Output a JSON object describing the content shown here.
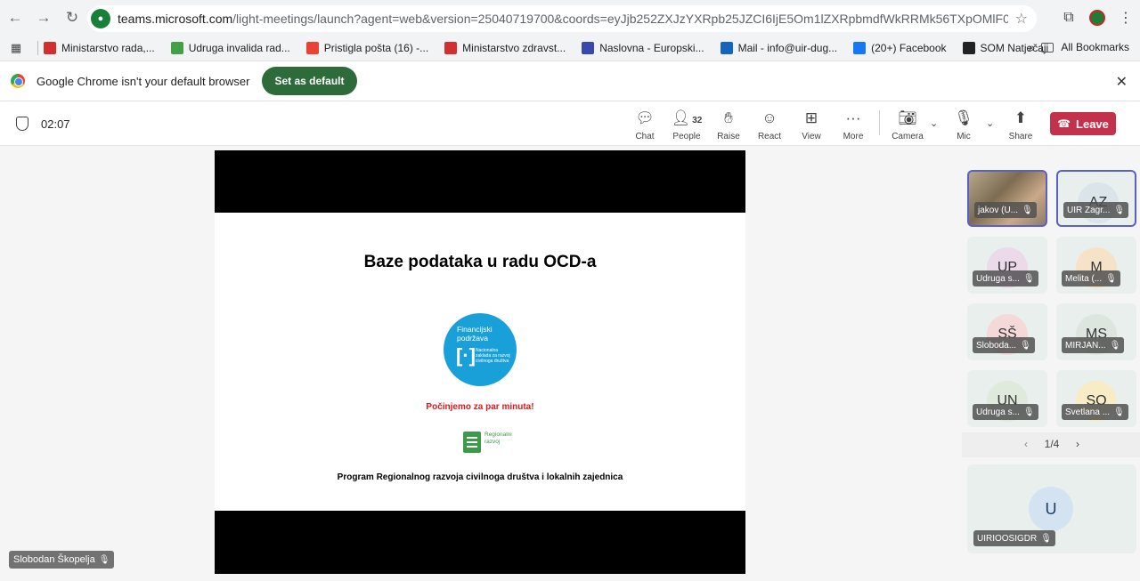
{
  "browser": {
    "url_domain": "teams.microsoft.com",
    "url_path": "/light-meetings/launch?agent=web&version=25040719700&coords=eyJjb252ZXJzYXRpb25JZCI6IjE5Om1lZXRpbmdfWkRRMk56TXpOMlF0WW1JNFI5MDBOREUyTFdJek9U...",
    "bookmarks": [
      {
        "label": "Ministarstvo rada,...",
        "color": "#d32f2f"
      },
      {
        "label": "Udruga invalida rad...",
        "color": "#43a047"
      },
      {
        "label": "Pristigla pošta (16) -...",
        "color": "#ea4335"
      },
      {
        "label": "Ministarstvo zdravst...",
        "color": "#d32f2f"
      },
      {
        "label": "Naslovna - Europski...",
        "color": "#3949ab"
      },
      {
        "label": "Mail - info@uir-dug...",
        "color": "#1565c0"
      },
      {
        "label": "(20+) Facebook",
        "color": "#1877f2"
      },
      {
        "label": "SOM Natječaji",
        "color": "#222222"
      }
    ],
    "more_bookmarks": "»",
    "all_bookmarks": "All Bookmarks"
  },
  "default_bar": {
    "text": "Google Chrome isn't your default browser",
    "button": "Set as default"
  },
  "meeting": {
    "timer": "02:07",
    "tools": {
      "chat": "Chat",
      "people": "People",
      "people_count": "32",
      "raise": "Raise",
      "react": "React",
      "view": "View",
      "more": "More",
      "camera": "Camera",
      "mic": "Mic",
      "share": "Share"
    },
    "leave": "Leave",
    "speaker_label": "Slobodan Škopelja"
  },
  "slide": {
    "title": "Baze podataka u radu OCD-a",
    "logo_line1": "Financijski",
    "logo_line2": "podržava",
    "logo_bracket": "[·]",
    "logo_small": "Nacionalna zaklada za razvoj civilnoga društva",
    "red_text": "Počinjemo za par minuta!",
    "rr_text": "Regionalni razvoj",
    "bottom_text": "Program Regionalnog razvoja civilnoga društva i lokalnih zajednica"
  },
  "participants": [
    {
      "initials": "",
      "name": "jakov (U...",
      "video": true,
      "active": true
    },
    {
      "initials": "AZ",
      "name": "UIR Zagr...",
      "color": "#dbe4e8",
      "active": true
    },
    {
      "initials": "UP",
      "name": "Udruga s...",
      "color": "#ecd9ea"
    },
    {
      "initials": "M",
      "name": "Melita (...",
      "color": "#f6e2c7"
    },
    {
      "initials": "SŠ",
      "name": "Sloboda...",
      "color": "#f5d8d8"
    },
    {
      "initials": "MS",
      "name": "MIRJAN...",
      "color": "#dde6de"
    },
    {
      "initials": "UN",
      "name": "Udruga s...",
      "color": "#dfeadc"
    },
    {
      "initials": "SO",
      "name": "Svetlana ...",
      "color": "#f7ecc6"
    }
  ],
  "pager": "1/4",
  "big_participant": {
    "initials": "U",
    "name": "UIRIOOSIGDR"
  }
}
